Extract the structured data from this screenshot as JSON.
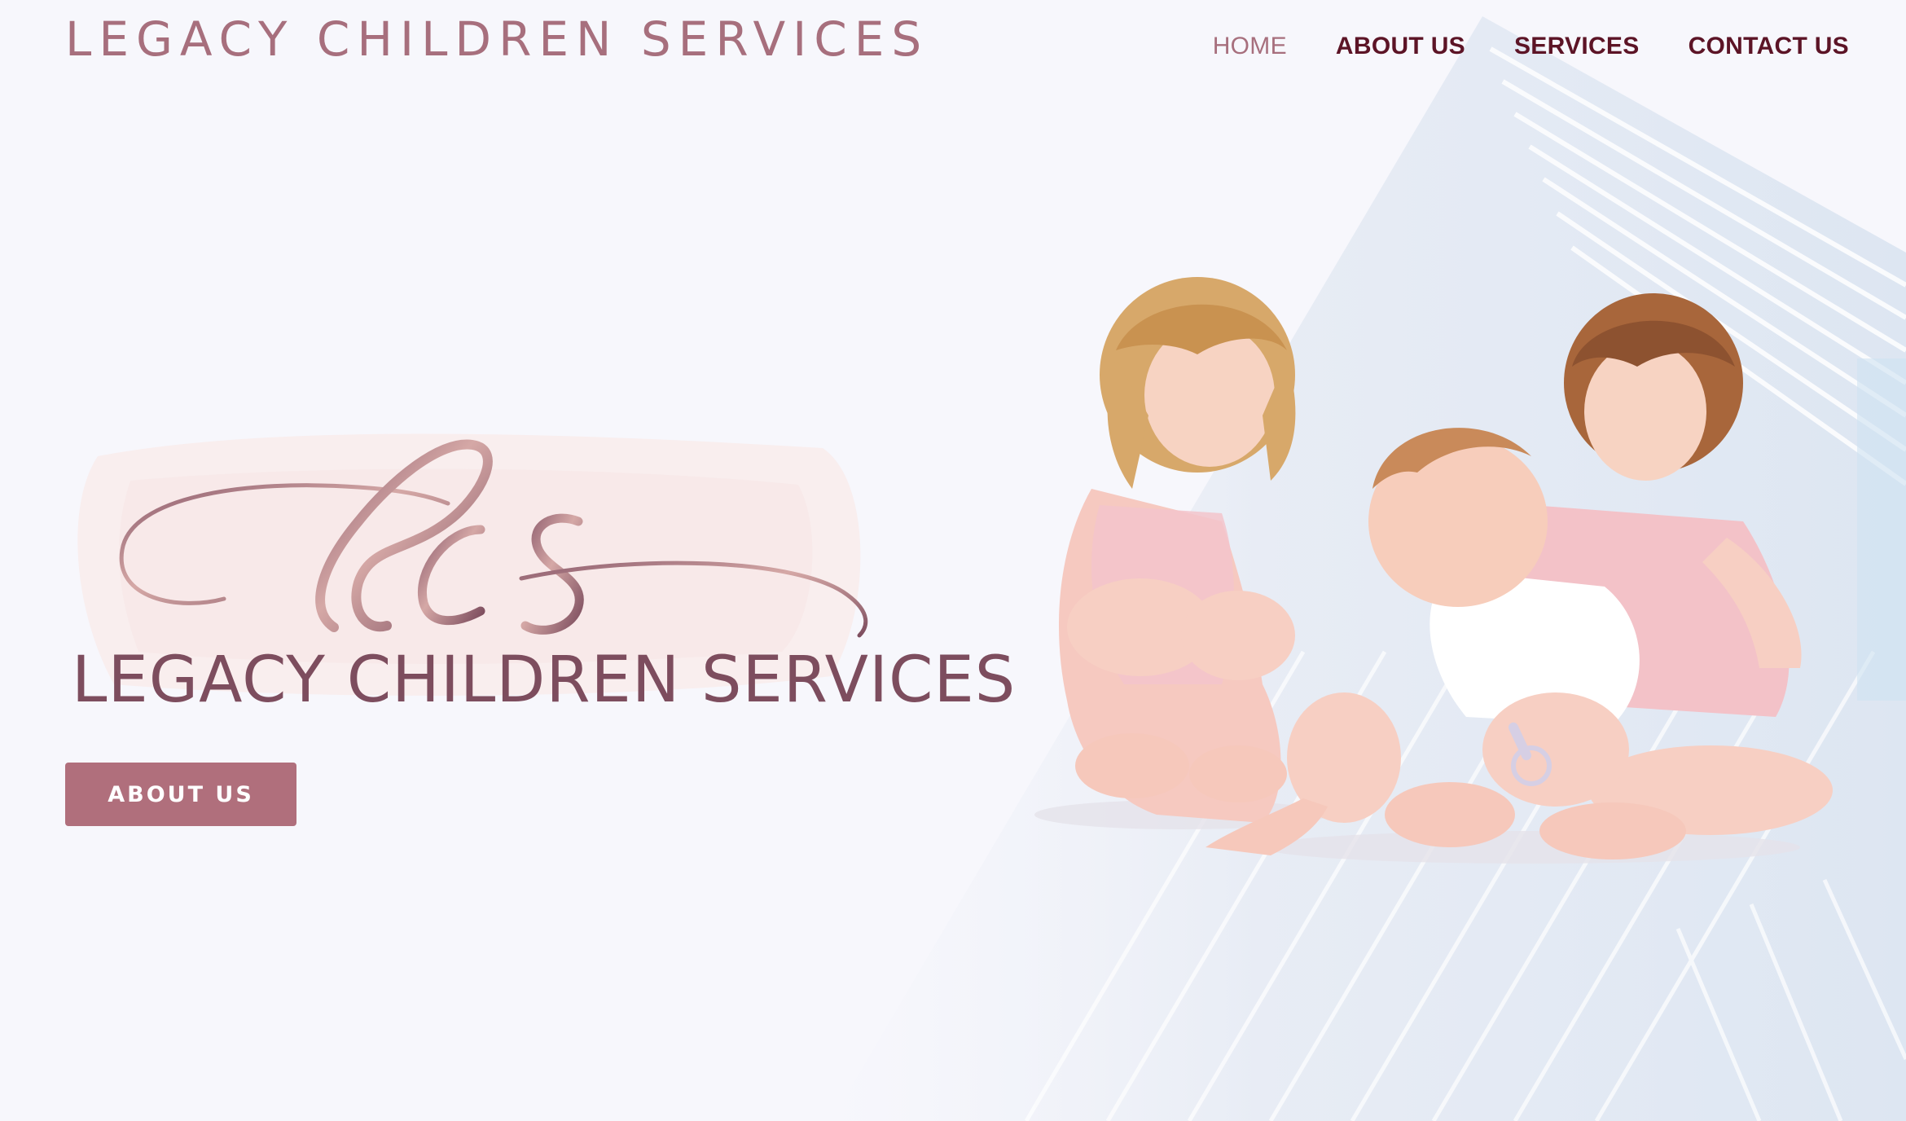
{
  "header": {
    "site_title": "LEGACY CHILDREN SERVICES",
    "nav": [
      {
        "label": "HOME",
        "active": true
      },
      {
        "label": "ABOUT US",
        "active": false
      },
      {
        "label": "SERVICES",
        "active": false
      },
      {
        "label": "CONTACT US",
        "active": false
      }
    ]
  },
  "hero": {
    "logo_monogram": "lcs",
    "logo_name": "LEGACY CHILDREN SERVICES",
    "cta_label": "ABOUT US"
  },
  "colors": {
    "brand_rose": "#b06f7c",
    "title_rose": "#a76f7d",
    "nav_maroon": "#5c1426",
    "background": "#f7f7fc"
  }
}
